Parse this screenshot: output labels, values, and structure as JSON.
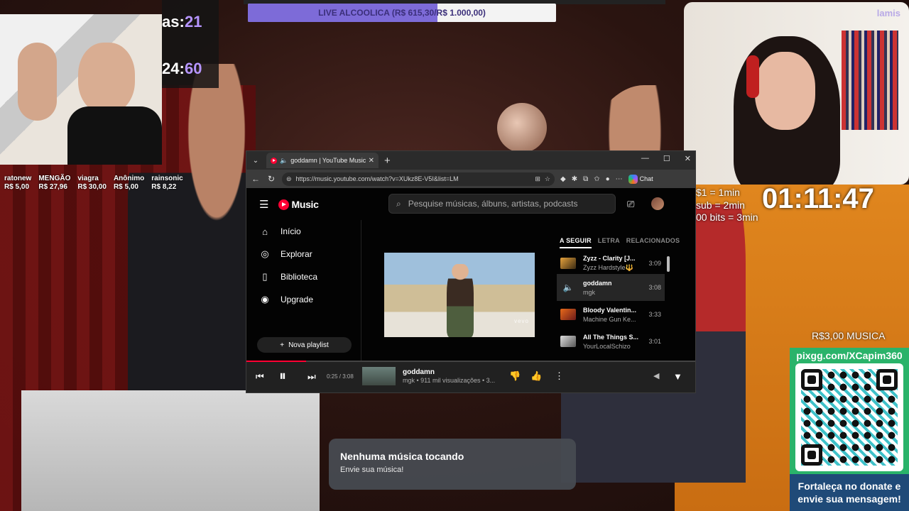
{
  "stream": {
    "goal_text": "LIVE ALCOOLICA (R$ 615,30/R$ 1.000,00)",
    "goal_progress": 0.6153,
    "counter_label_1": "as:",
    "counter_value_1": "21",
    "counter_label_2": "24:",
    "counter_value_2": "60",
    "donors": [
      {
        "name": "ratonew",
        "amount": "R$ 5,00"
      },
      {
        "name": "MENGÃO",
        "amount": "R$ 27,96"
      },
      {
        "name": "viagra",
        "amount": "R$ 30,00"
      },
      {
        "name": "Anônimo",
        "amount": "R$ 5,00"
      },
      {
        "name": "rainsonic",
        "amount": "R$ 8,22"
      }
    ],
    "watermark": "lamis",
    "rates": [
      "$1 = 1min",
      "sub = 2min",
      "00 bits = 3min"
    ],
    "timer": "01:11:47",
    "music_price": "R$3,00 MUSICA",
    "pix_key": "pixgg.com/XCapim360",
    "qr_footer_1": "Fortaleça no donate e",
    "qr_footer_2": "envie sua mensagem!",
    "now_playing_title": "Nenhuma música tocando",
    "now_playing_sub": "Envie sua música!"
  },
  "browser": {
    "tab_title": "goddamn | YouTube Music",
    "url": "https://music.youtube.com/watch?v=XUkz8E-V5I&list=LM",
    "chat_label": "Chat"
  },
  "ytm": {
    "logo": "Music",
    "search_placeholder": "Pesquise músicas, álbuns, artistas, podcasts",
    "nav": [
      "Início",
      "Explorar",
      "Biblioteca",
      "Upgrade"
    ],
    "new_playlist": "Nova playlist",
    "vevo": "vevo",
    "queue_tabs": [
      "A SEGUIR",
      "LETRA",
      "RELACIONADOS"
    ],
    "queue": [
      {
        "title": "Zyzz - Clarity [J...",
        "artist": "Zyzz Hardstyle🔱",
        "duration": "3:09"
      },
      {
        "title": "goddamn",
        "artist": "mgk",
        "duration": "3:08"
      },
      {
        "title": "Bloody Valentin...",
        "artist": "Machine Gun Ke...",
        "duration": "3:33"
      },
      {
        "title": "All The Things S...",
        "artist": "YourLocalSchizo",
        "duration": "3:01"
      }
    ],
    "player": {
      "time": "0:25 / 3:08",
      "progress": 0.133,
      "title": "goddamn",
      "meta": "mgk • 911 mil visualizações • 3..."
    }
  }
}
